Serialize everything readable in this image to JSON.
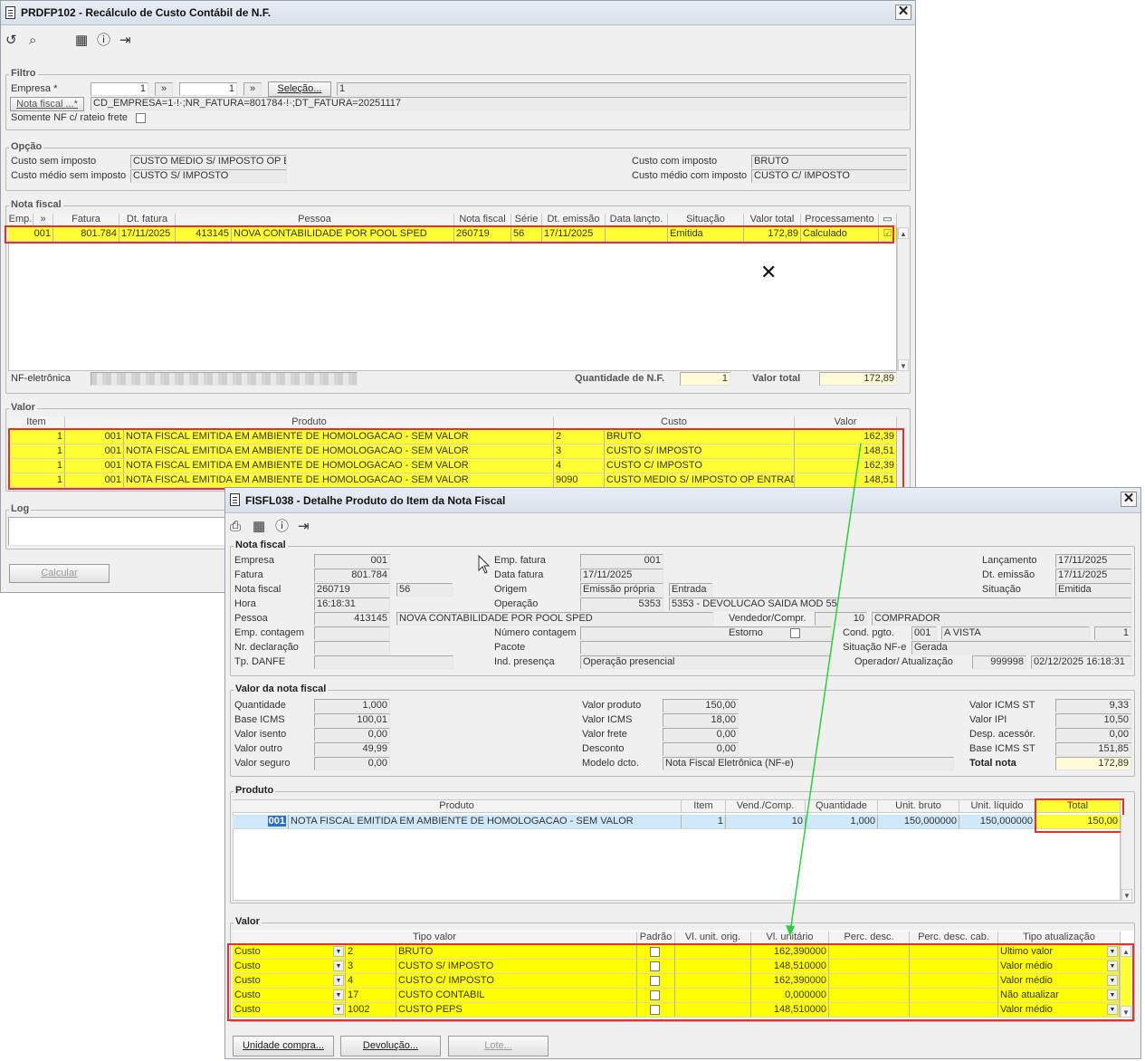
{
  "w1": {
    "title": "PRDFP102 - Recálculo de Custo Contábil de N.F.",
    "filtro": {
      "legend": "Filtro",
      "empresa_label": "Empresa *",
      "empresa_de": "1",
      "empresa_ate": "1",
      "selecao_label": "Seleção...",
      "selecao_value": "1",
      "nota_fiscal_button": "Nota fiscal ...*",
      "nota_fiscal_value": "CD_EMPRESA=1·!·;NR_FATURA=801784·!·;DT_FATURA=20251117",
      "somente_label": "Somente NF c/ rateio frete"
    },
    "opcao": {
      "legend": "Opção",
      "custo_sem_label": "Custo sem imposto",
      "custo_sem_value": "CUSTO MEDIO S/ IMPOSTO OP ENT",
      "custo_medio_sem_label": "Custo médio sem imposto",
      "custo_medio_sem_value": "CUSTO S/ IMPOSTO",
      "custo_com_label": "Custo com imposto",
      "custo_com_value": "BRUTO",
      "custo_medio_com_label": "Custo médio com imposto",
      "custo_medio_com_value": "CUSTO C/ IMPOSTO"
    },
    "nota_fiscal": {
      "legend": "Nota fiscal",
      "columns": [
        "Emp.",
        "Fatura",
        "Dt. fatura",
        "Pessoa",
        "Nota fiscal",
        "Série",
        "Dt. emissão",
        "Data lançto.",
        "Situação",
        "Valor total",
        "Processamento"
      ],
      "row": {
        "emp": "001",
        "fatura": "801.784",
        "dt_fatura": "17/11/2025",
        "pessoa_cod": "413145",
        "pessoa_nome": "NOVA CONTABILIDADE POR POOL SPED",
        "nota_fiscal": "260719",
        "serie": "56",
        "dt_emissao": "17/11/2025",
        "data_lancto": "",
        "situacao": "Emitida",
        "valor_total": "172,89",
        "processamento": "Calculado"
      },
      "nf_eletronica_label": "NF-eletrônica",
      "quantidade_label": "Quantidade de N.F.",
      "quantidade_value": "1",
      "valor_total_label": "Valor total",
      "valor_total_value": "172,89"
    },
    "valor": {
      "legend": "Valor",
      "columns": [
        "Item",
        "Produto",
        "Custo",
        "Valor"
      ],
      "rows": [
        {
          "item": "1",
          "cod": "001",
          "produto": "NOTA FISCAL EMITIDA EM AMBIENTE DE HOMOLOGACAO - SEM VALOR",
          "custo_cod": "2",
          "custo": "BRUTO",
          "valor": "162,39"
        },
        {
          "item": "1",
          "cod": "001",
          "produto": "NOTA FISCAL EMITIDA EM AMBIENTE DE HOMOLOGACAO - SEM VALOR",
          "custo_cod": "3",
          "custo": "CUSTO S/ IMPOSTO",
          "valor": "148,51"
        },
        {
          "item": "1",
          "cod": "001",
          "produto": "NOTA FISCAL EMITIDA EM AMBIENTE DE HOMOLOGACAO - SEM VALOR",
          "custo_cod": "4",
          "custo": "CUSTO C/ IMPOSTO",
          "valor": "162,39"
        },
        {
          "item": "1",
          "cod": "001",
          "produto": "NOTA FISCAL EMITIDA EM AMBIENTE DE HOMOLOGACAO - SEM VALOR",
          "custo_cod": "9090",
          "custo": "CUSTO MEDIO S/ IMPOSTO OP ENTRADA",
          "valor": "148,51"
        }
      ]
    },
    "log_legend": "Log",
    "calcular_button": "Calcular"
  },
  "w2": {
    "title": "FISFL038 - Detalhe Produto do Item da Nota Fiscal",
    "nf": {
      "legend": "Nota fiscal",
      "empresa_label": "Empresa",
      "empresa": "001",
      "fatura_label": "Fatura",
      "fatura": "801.784",
      "nota_fiscal_label": "Nota fiscal",
      "nota_fiscal": "260719",
      "serie": "56",
      "hora_label": "Hora",
      "hora": "16:18:31",
      "pessoa_label": "Pessoa",
      "pessoa_cod": "413145",
      "pessoa_nome": "NOVA CONTABILIDADE POR POOL SPED",
      "emp_contagem_label": "Emp. contagem",
      "nr_declaracao_label": "Nr. declaração",
      "tp_danfe_label": "Tp. DANFE",
      "emp_fatura_label": "Emp. fatura",
      "emp_fatura": "001",
      "data_fatura_label": "Data fatura",
      "data_fatura": "17/11/2025",
      "origem_label": "Origem",
      "origem": "Emissão própria",
      "origem_tipo": "Entrada",
      "operacao_label": "Operação",
      "operacao_cod": "5353",
      "operacao_desc": "5353 - DEVOLUCAO SAIDA  MOD 55",
      "numero_contagem_label": "Número contagem",
      "pacote_label": "Pacote",
      "ind_presenca_label": "Ind. presença",
      "ind_presenca": "Operação presencial",
      "vendedor_label": "Vendedor/Compr.",
      "vendedor_cod": "10",
      "vendedor_nome": "COMPRADOR",
      "estorno_label": "Estorno",
      "lancamento_label": "Lançamento",
      "lancamento": "17/11/2025",
      "dt_emissao_label": "Dt. emissão",
      "dt_emissao": "17/11/2025",
      "situacao_label": "Situação",
      "situacao": "Emitida",
      "cond_pgto_label": "Cond. pgto.",
      "cond_pgto_cod": "001",
      "cond_pgto_desc": "A VISTA",
      "cond_pgto_n": "1",
      "situacao_nfe_label": "Situação NF-e",
      "situacao_nfe": "Gerada",
      "operador_label": "Operador/ Atualização",
      "operador": "999998",
      "atualizacao": "02/12/2025 16:18:31"
    },
    "vnf": {
      "legend": "Valor da nota fiscal",
      "quantidade_label": "Quantidade",
      "quantidade": "1,000",
      "base_icms_label": "Base ICMS",
      "base_icms": "100,01",
      "valor_isento_label": "Valor isento",
      "valor_isento": "0,00",
      "valor_outro_label": "Valor outro",
      "valor_outro": "49,99",
      "valor_seguro_label": "Valor seguro",
      "valor_seguro": "0,00",
      "valor_produto_label": "Valor produto",
      "valor_produto": "150,00",
      "valor_icms_label": "Valor ICMS",
      "valor_icms": "18,00",
      "valor_frete_label": "Valor frete",
      "valor_frete": "0,00",
      "desconto_label": "Desconto",
      "desconto": "0,00",
      "modelo_label": "Modelo dcto.",
      "modelo": "Nota Fiscal Eletrônica (NF-e)",
      "valor_icms_st_label": "Valor ICMS ST",
      "valor_icms_st": "9,33",
      "valor_ipi_label": "Valor IPI",
      "valor_ipi": "10,50",
      "desp_acessor_label": "Desp. acessór.",
      "desp_acessor": "0,00",
      "base_icms_st_label": "Base ICMS ST",
      "base_icms_st": "151,85",
      "total_nota_label": "Total nota",
      "total_nota": "172,89"
    },
    "produto": {
      "legend": "Produto",
      "columns": [
        "Produto",
        "Item",
        "Vend./Comp.",
        "Quantidade",
        "Unit. bruto",
        "Unit. líquido",
        "Total"
      ],
      "row": {
        "cod": "001",
        "produto": "NOTA FISCAL EMITIDA EM AMBIENTE DE HOMOLOGACAO - SEM VALOR",
        "item": "1",
        "vend": "10",
        "quantidade": "1,000",
        "unit_bruto": "150,000000",
        "unit_liquido": "150,000000",
        "total": "150,00"
      }
    },
    "valor": {
      "legend": "Valor",
      "columns": [
        "Tipo valor",
        "Padrão",
        "Vl. unit. orig.",
        "Vl. unitário",
        "Perc. desc.",
        "Perc. desc. cab.",
        "Tipo atualização"
      ],
      "rows": [
        {
          "tipo": "Custo",
          "cod": "2",
          "desc": "BRUTO",
          "vl_unit": "162,390000",
          "atualizacao": "Ultimo valor"
        },
        {
          "tipo": "Custo",
          "cod": "3",
          "desc": "CUSTO S/ IMPOSTO",
          "vl_unit": "148,510000",
          "atualizacao": "Valor médio"
        },
        {
          "tipo": "Custo",
          "cod": "4",
          "desc": "CUSTO C/ IMPOSTO",
          "vl_unit": "162,390000",
          "atualizacao": "Valor médio"
        },
        {
          "tipo": "Custo",
          "cod": "17",
          "desc": "CUSTO CONTABIL",
          "vl_unit": "0,000000",
          "atualizacao": "Não atualizar"
        },
        {
          "tipo": "Custo",
          "cod": "1002",
          "desc": "CUSTO PEPS",
          "vl_unit": "148,510000",
          "atualizacao": "Valor médio"
        }
      ]
    },
    "buttons": {
      "unidade_compra": "Unidade compra...",
      "devolucao": "Devolução...",
      "lote": "Lote..."
    }
  },
  "colors": {
    "highlight": "#ffff33",
    "annotation_box": "#e53030",
    "arrow": "#2ecc40",
    "selection": "#cfe8fb"
  },
  "icons": [
    "undo-icon",
    "search-icon",
    "calendar-icon",
    "help-icon",
    "exit-icon",
    "print-icon",
    "close-icon",
    "dropdown-arrow-icon"
  ]
}
